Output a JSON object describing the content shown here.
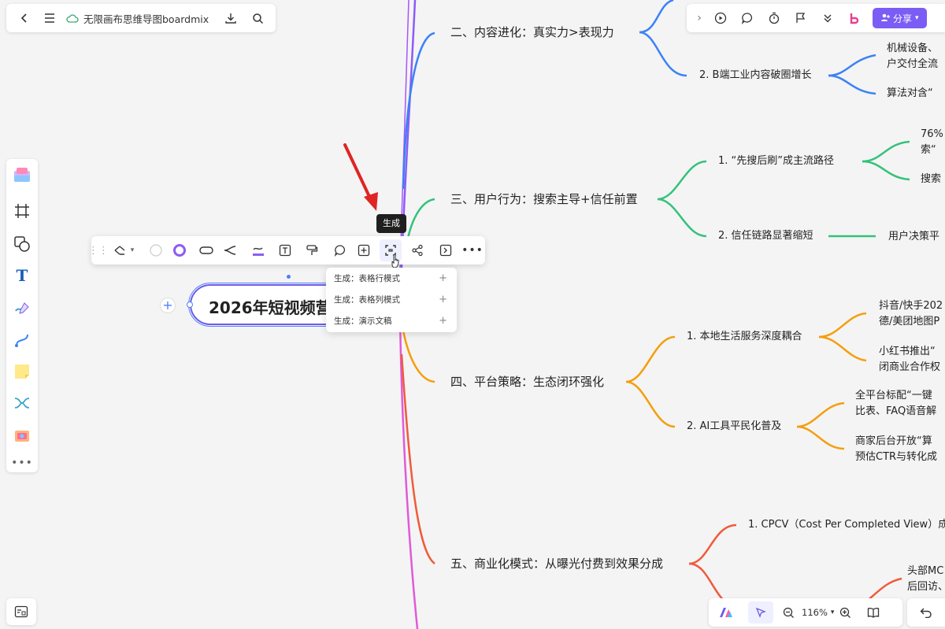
{
  "header": {
    "doc_title": "无限画布思维导图boardmix"
  },
  "topbar": {
    "share_label": "分享",
    "brand_color": "#7b5cf5"
  },
  "mindmap": {
    "root": "2026年短视频营销",
    "branches": [
      {
        "label": "二、内容进化：真实力>表现力",
        "color": "#3b82f6"
      },
      {
        "label": "三、用户行为：搜索主导+信任前置",
        "color": "#34c27a"
      },
      {
        "label": "四、平台策略：生态闭环强化",
        "color": "#f59e0b"
      },
      {
        "label": "五、商业化模式：从曝光付费到效果分成",
        "color": "#f05a3a"
      }
    ],
    "subs": {
      "b2_2": "2. B端工业内容破圈增长",
      "b3_1": "1. “先搜后刷”成主流路径",
      "b3_2": "2. 信任链路显著缩短",
      "b4_1": "1. 本地生活服务深度耦合",
      "b4_2": "2. AI工具平民化普及",
      "b5_1": "1. CPCV（Cost Per Completed View）成"
    },
    "leaves": {
      "b2_2a_l1": "机械设备、",
      "b2_2a_l2": "户交付全流",
      "b2_2b": "算法对含“",
      "b3_1a_l1": "76%",
      "b3_1a_l2": "索“",
      "b3_1b": "搜索",
      "b3_2a": "用户决策平",
      "b4_1a_l1": "抖音/快手202",
      "b4_1a_l2": "德/美团地图P",
      "b4_1b_l1": "小红书推出“",
      "b4_1b_l2": "闭商业合作权",
      "b4_2a_l1": "全平台标配“一键",
      "b4_2a_l2": "比表、FAQ语音解",
      "b4_2b_l1": "商家后台开放“算",
      "b4_2b_l2": "预估CTR与转化成",
      "b5_2a_l1": "头部MC",
      "b5_2a_l2": "后回访、"
    }
  },
  "format_toolbar": {
    "tooltip": "生成",
    "menu": [
      {
        "label": "生成：表格行模式"
      },
      {
        "label": "生成：表格列模式"
      },
      {
        "label": "生成：演示文稿"
      }
    ]
  },
  "bottombar": {
    "zoom": "116%"
  },
  "icons": [
    "back-icon",
    "menu-icon",
    "cloud-icon",
    "download-icon",
    "search-icon",
    "play-icon",
    "comment-icon",
    "timer-icon",
    "flag-icon",
    "chevron-double-icon",
    "user-add-icon",
    "frame-icon",
    "shape-icon",
    "text-icon",
    "pen-icon",
    "connector-icon",
    "sticky-note-icon",
    "mindmap-icon",
    "template-icon",
    "more-icon",
    "drag-handle-icon",
    "ai-icon",
    "cursor-icon",
    "zoom-out-icon",
    "zoom-in-icon",
    "book-icon",
    "undo-icon",
    "minimap-icon"
  ]
}
